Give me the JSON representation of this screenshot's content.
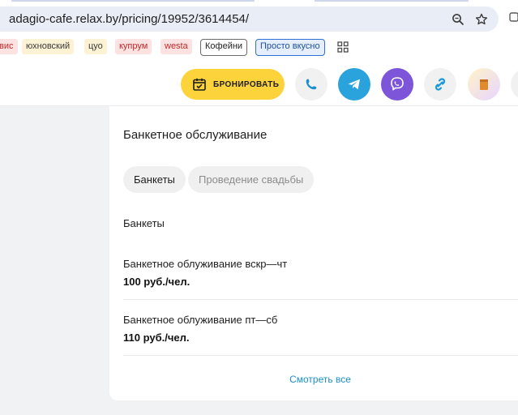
{
  "browser": {
    "url": "adagio-cafe.relax.by/pricing/19952/3614454/",
    "bookmarks": [
      {
        "label": "вис",
        "bg": "#fde2e2",
        "fg": "#c62828",
        "style": "tag"
      },
      {
        "label": "юхновский",
        "bg": "#fdf3d4",
        "fg": "#3a3a3a",
        "style": "tag"
      },
      {
        "label": "цуо",
        "bg": "#fdf3d4",
        "fg": "#3a3a3a",
        "style": "tag"
      },
      {
        "label": "купрум",
        "bg": "#fde2e2",
        "fg": "#c62828",
        "style": "tag"
      },
      {
        "label": "westa",
        "bg": "#fde2e2",
        "fg": "#c62828",
        "style": "tag"
      },
      {
        "label": "Кофейни",
        "style": "outline"
      },
      {
        "label": "Просто вкусно",
        "style": "blue"
      }
    ]
  },
  "header": {
    "book_label": "БРОНИРОВАТЬ",
    "icons": [
      "phone-icon",
      "telegram-icon",
      "viber-icon",
      "link-icon",
      "bag-icon"
    ],
    "colors": {
      "accent": "#fdd33c",
      "telegram": "#2aa3dc",
      "viber": "#7d55d8",
      "link": "#1a9ad6"
    }
  },
  "card": {
    "title": "Банкетное обслуживание",
    "chips": [
      {
        "label": "Банкеты",
        "active": true
      },
      {
        "label": "Проведение свадьбы",
        "active": false
      }
    ],
    "section_label": "Банкеты",
    "items": [
      {
        "name": "Банкетное облуживание вскр—чт",
        "price": "100 руб./чел."
      },
      {
        "name": "Банкетное облуживание пт—сб",
        "price": "110 руб./чел."
      }
    ],
    "see_all": "Смотреть все",
    "link_color": "#1a8fc9"
  }
}
